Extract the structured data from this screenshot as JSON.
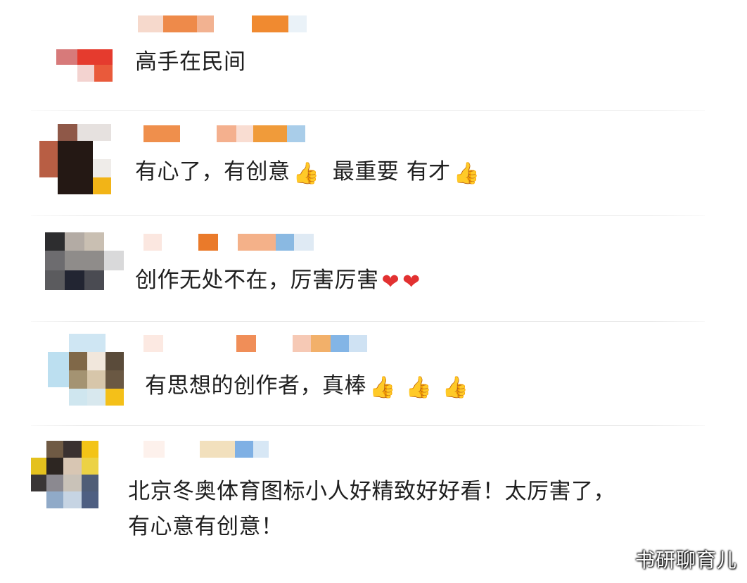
{
  "comments": [
    {
      "text": "高手在民间",
      "emoji": []
    },
    {
      "text": "有心了，有创意",
      "emoji": [
        "👍"
      ],
      "text2": "最重要 有才",
      "emoji2": [
        "👍"
      ]
    },
    {
      "text": "创作无处不在，厉害厉害",
      "emoji": [
        "❤️",
        "❤️"
      ]
    },
    {
      "text": "有思想的创作者，真棒",
      "emoji": [
        "👍",
        "👍",
        "👍"
      ]
    },
    {
      "line1": "北京冬奥体育图标小人好精致好好看！太厉害了，",
      "line2": "有心意有创意！"
    }
  ],
  "watermark": "书研聊育儿",
  "colors": {
    "background": "#ffffff",
    "text": "#1f1f1f",
    "heart": "#e23131",
    "thumb": "#e8b77e"
  },
  "icons": [
    "thumbs-up-icon",
    "heart-icon"
  ]
}
